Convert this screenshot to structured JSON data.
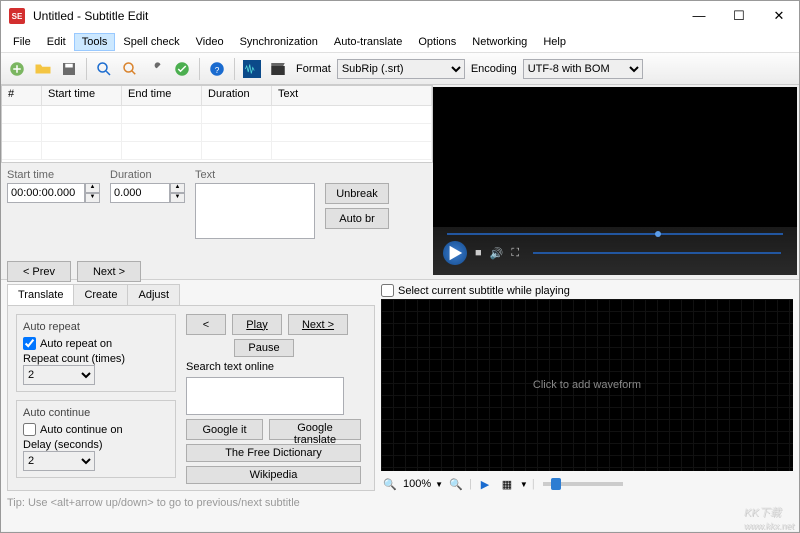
{
  "window": {
    "title": "Untitled - Subtitle Edit",
    "icon_text": "SE"
  },
  "menus": [
    "File",
    "Edit",
    "Tools",
    "Spell check",
    "Video",
    "Synchronization",
    "Auto-translate",
    "Options",
    "Networking",
    "Help"
  ],
  "active_menu_index": 2,
  "toolbar": {
    "format_label": "Format",
    "format_value": "SubRip (.srt)",
    "encoding_label": "Encoding",
    "encoding_value": "UTF-8 with BOM"
  },
  "grid": {
    "cols": [
      "#",
      "Start time",
      "End time",
      "Duration",
      "Text"
    ],
    "widths": [
      40,
      80,
      80,
      70,
      160
    ]
  },
  "edit": {
    "start_label": "Start time",
    "start_value": "00:00:00.000",
    "duration_label": "Duration",
    "duration_value": "0.000",
    "text_label": "Text",
    "unbreak": "Unbreak",
    "autobr": "Auto br",
    "prev": "< Prev",
    "next": "Next >"
  },
  "tabs": [
    "Translate",
    "Create",
    "Adjust"
  ],
  "active_tab_index": 0,
  "translate": {
    "autorepeat_title": "Auto repeat",
    "autorepeat_on": "Auto repeat on",
    "autorepeat_on_checked": true,
    "repeat_count_label": "Repeat count (times)",
    "repeat_count_value": "2",
    "autocontinue_title": "Auto continue",
    "autocontinue_on": "Auto continue on",
    "autocontinue_on_checked": false,
    "delay_label": "Delay (seconds)",
    "delay_value": "2",
    "back": "<",
    "play": "Play",
    "next": "Next >",
    "pause": "Pause",
    "search_label": "Search text online",
    "google_it": "Google it",
    "google_translate": "Google translate",
    "free_dict": "The Free Dictionary",
    "wikipedia": "Wikipedia"
  },
  "tip": "Tip: Use <alt+arrow up/down> to go to previous/next subtitle",
  "waveform": {
    "select_current": "Select current subtitle while playing",
    "placeholder": "Click to add waveform",
    "zoom": "100%"
  },
  "watermark": {
    "main": "KK下载",
    "sub": "www.kkx.net"
  }
}
